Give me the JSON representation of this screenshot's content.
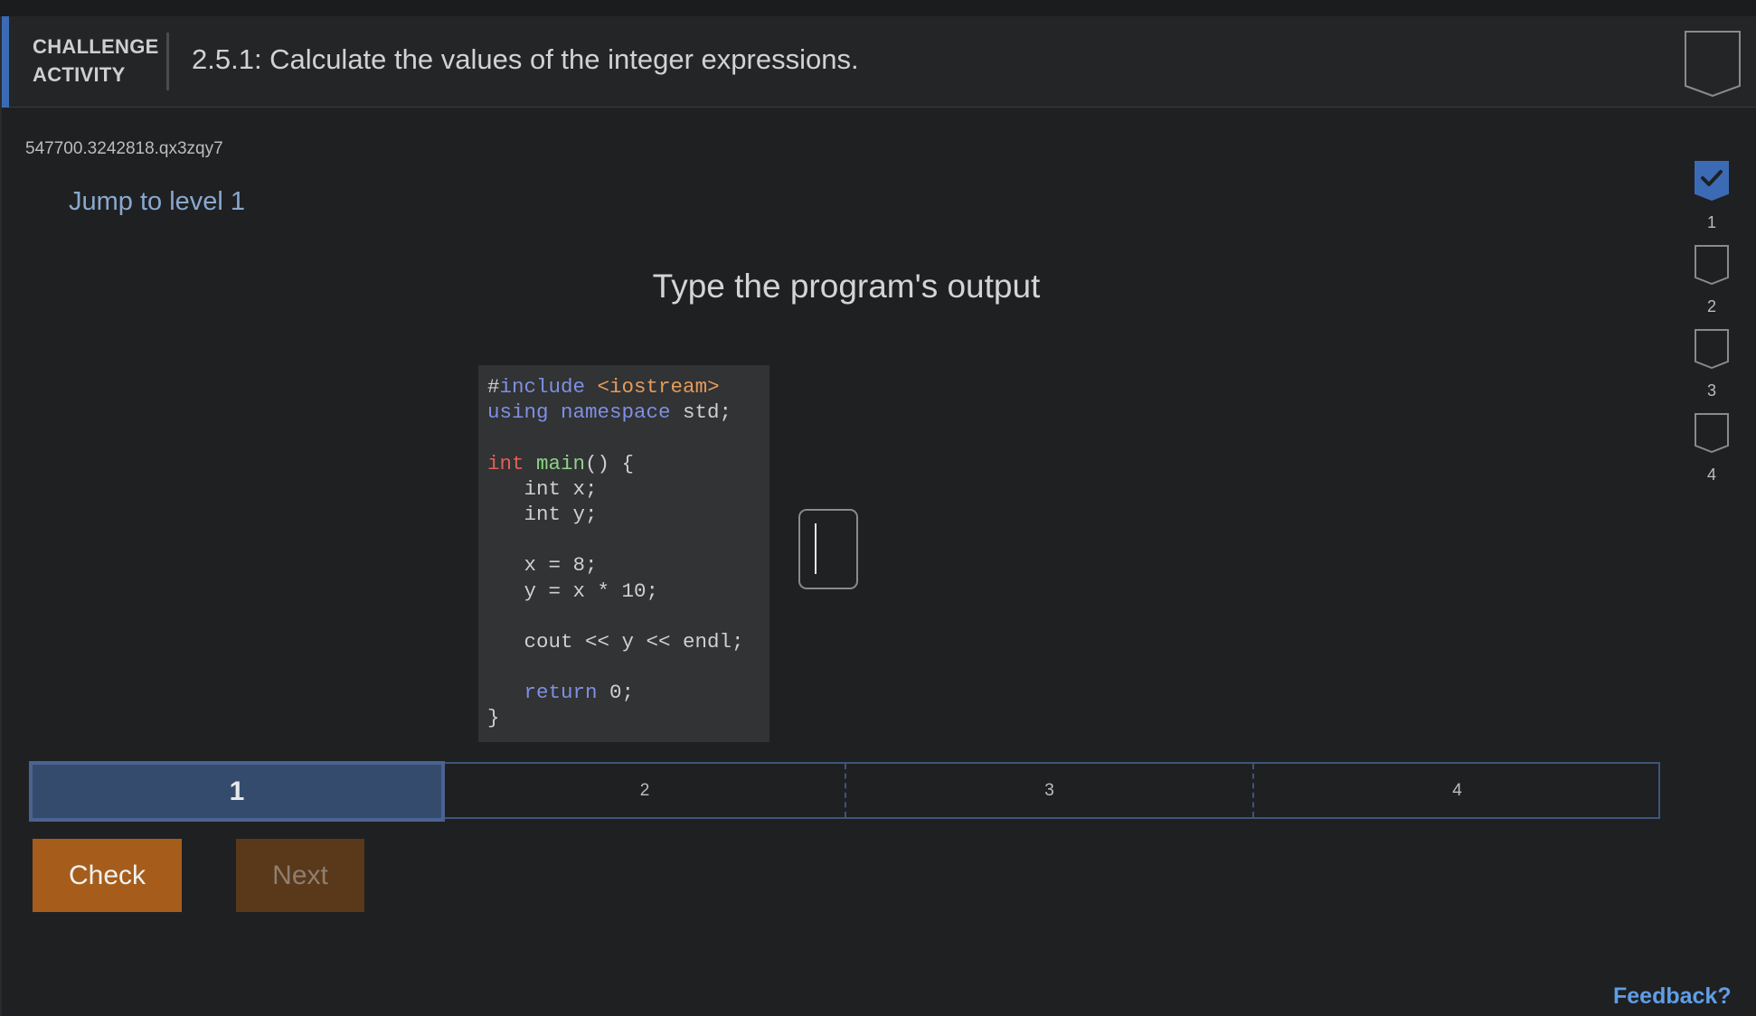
{
  "header": {
    "activity_label_line1": "CHALLENGE",
    "activity_label_line2": "ACTIVITY",
    "title": "2.5.1: Calculate the values of the integer expressions."
  },
  "activity_id": "547700.3242818.qx3zqy7",
  "jump_link": "Jump to level 1",
  "prompt": "Type the program's output",
  "code_lines": [
    [
      {
        "t": "#",
        "c": "plain"
      },
      {
        "t": "include ",
        "c": "kw"
      },
      {
        "t": "<iostream>",
        "c": "str"
      }
    ],
    [
      {
        "t": "using namespace ",
        "c": "kw"
      },
      {
        "t": "std;",
        "c": "plain"
      }
    ],
    [],
    [
      {
        "t": "int ",
        "c": "type"
      },
      {
        "t": "main",
        "c": "fn"
      },
      {
        "t": "() {",
        "c": "plain"
      }
    ],
    [
      {
        "t": "   int x;",
        "c": "plain"
      }
    ],
    [
      {
        "t": "   int y;",
        "c": "plain"
      }
    ],
    [],
    [
      {
        "t": "   x = 8;",
        "c": "plain"
      }
    ],
    [
      {
        "t": "   y = x * 10;",
        "c": "plain"
      }
    ],
    [],
    [
      {
        "t": "   cout << y << endl;",
        "c": "plain"
      }
    ],
    [],
    [
      {
        "t": "   ",
        "c": "plain"
      },
      {
        "t": "return ",
        "c": "kw"
      },
      {
        "t": "0;",
        "c": "plain"
      }
    ],
    [
      {
        "t": "}",
        "c": "plain"
      }
    ]
  ],
  "answer": {
    "value": ""
  },
  "levels": [
    {
      "label": "1",
      "active": true
    },
    {
      "label": "2",
      "active": false
    },
    {
      "label": "3",
      "active": false
    },
    {
      "label": "4",
      "active": false
    }
  ],
  "buttons": {
    "check": "Check",
    "next": "Next"
  },
  "feedback": "Feedback?",
  "level_rail": [
    {
      "label": "1",
      "completed": true
    },
    {
      "label": "2",
      "completed": false
    },
    {
      "label": "3",
      "completed": false
    },
    {
      "label": "4",
      "completed": false
    }
  ],
  "colors": {
    "accent": "#3c6bb5",
    "check": "#a65d1c",
    "next_disabled": "#5a381a",
    "link": "#5f9ee6"
  }
}
